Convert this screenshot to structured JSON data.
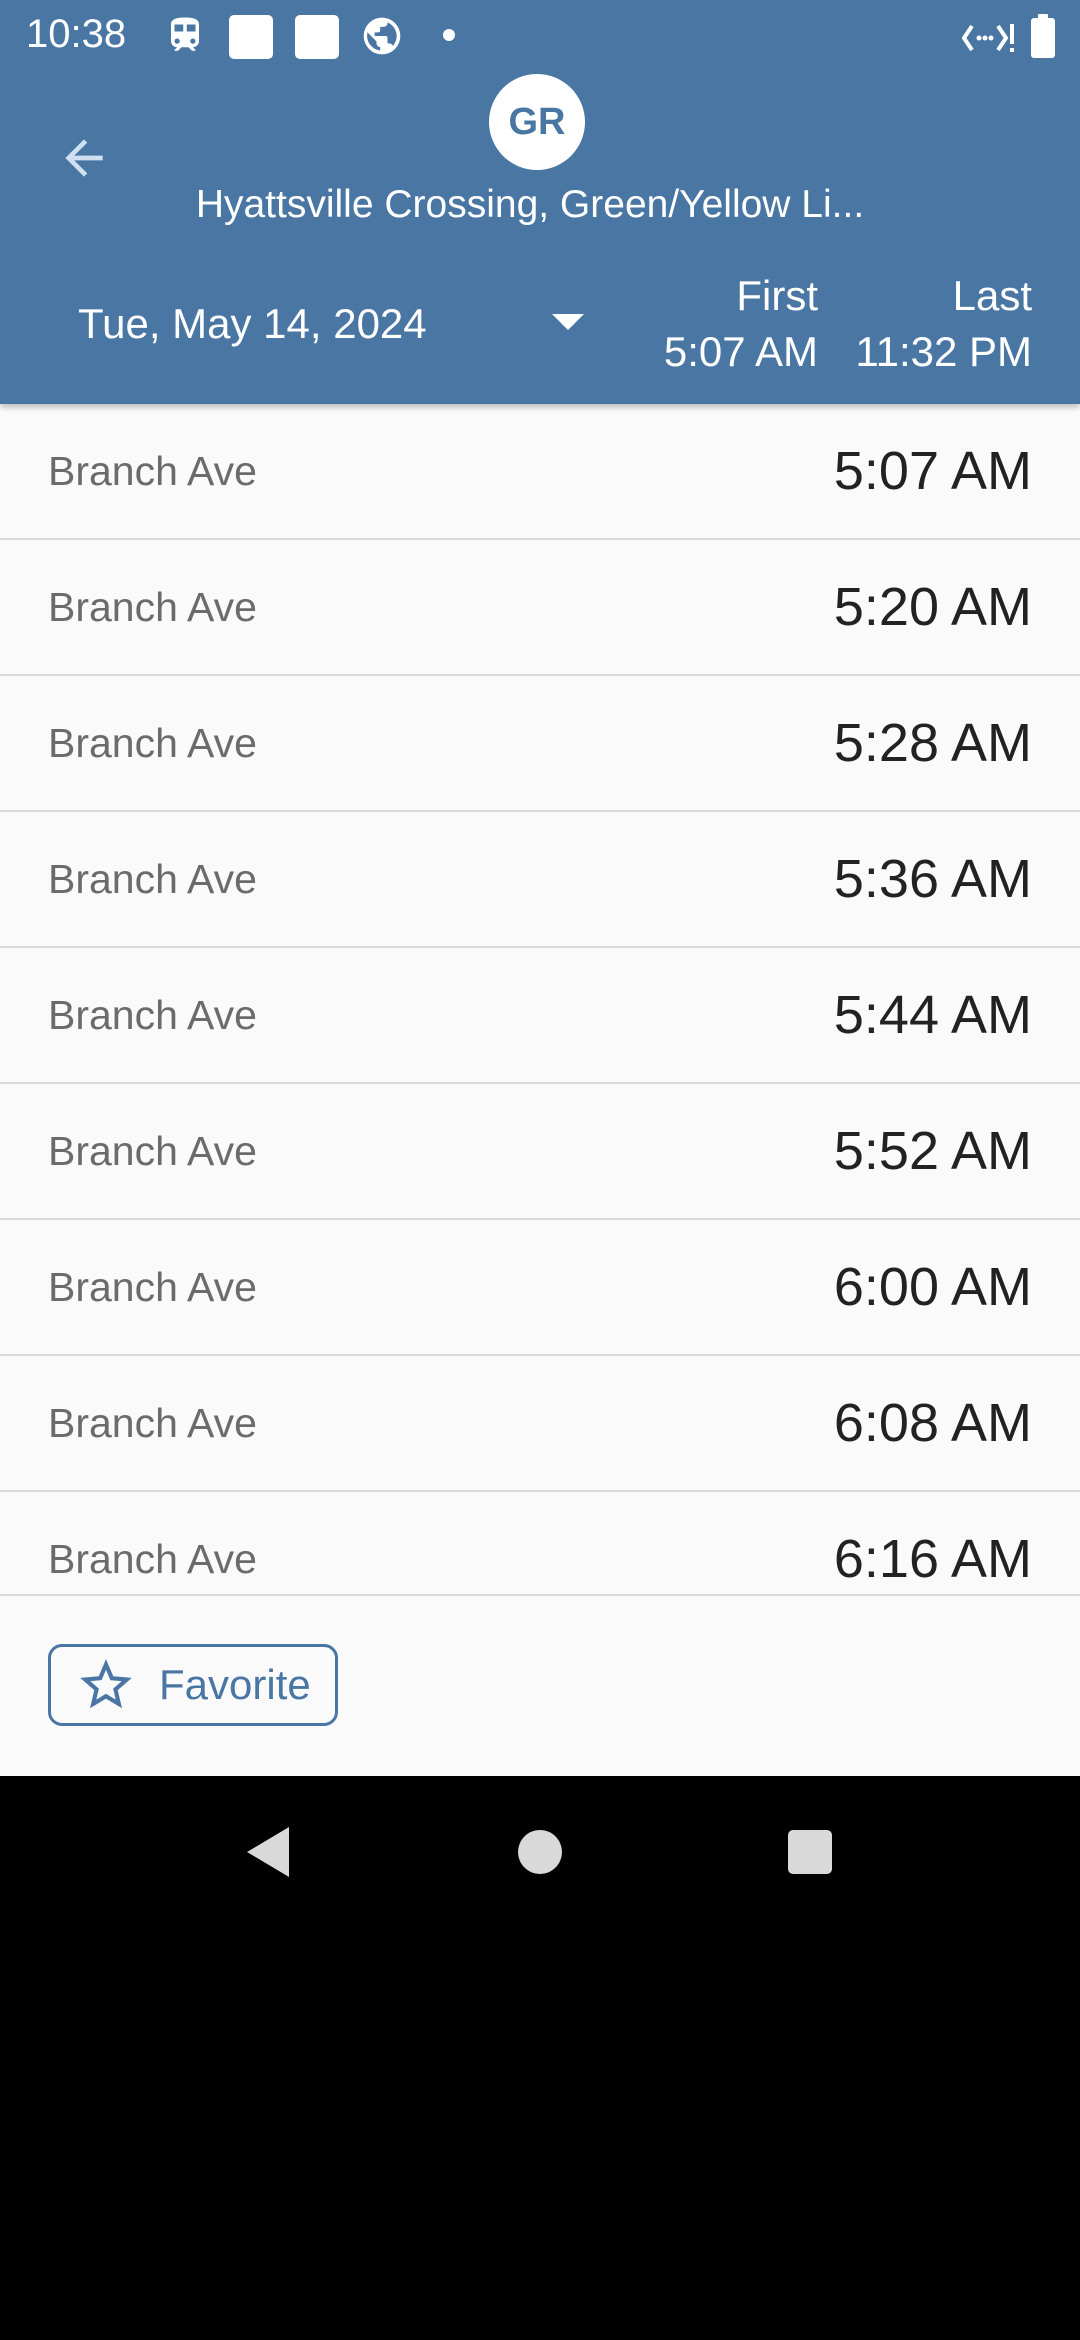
{
  "status_bar": {
    "time": "10:38",
    "icons": [
      "train-icon",
      "notification-square-icon",
      "notification-square-icon",
      "globe-icon",
      "dot-icon",
      "wifi-calling-icon",
      "battery-icon"
    ]
  },
  "header": {
    "back_icon": "arrow-left-icon",
    "line_badge": "GR",
    "station_title": "Hyattsville Crossing, Green/Yellow Li...",
    "date": "Tue, May 14, 2024",
    "first_label": "First",
    "first_time": "5:07 AM",
    "last_label": "Last",
    "last_time": "11:32 PM"
  },
  "schedule": [
    {
      "destination": "Branch Ave",
      "time": "5:07 AM"
    },
    {
      "destination": "Branch Ave",
      "time": "5:20 AM"
    },
    {
      "destination": "Branch Ave",
      "time": "5:28 AM"
    },
    {
      "destination": "Branch Ave",
      "time": "5:36 AM"
    },
    {
      "destination": "Branch Ave",
      "time": "5:44 AM"
    },
    {
      "destination": "Branch Ave",
      "time": "5:52 AM"
    },
    {
      "destination": "Branch Ave",
      "time": "6:00 AM"
    },
    {
      "destination": "Branch Ave",
      "time": "6:08 AM"
    },
    {
      "destination": "Branch Ave",
      "time": "6:16 AM"
    }
  ],
  "favorite": {
    "label": "Favorite",
    "icon": "star-outline-icon"
  },
  "colors": {
    "header": "#4a76a4",
    "background": "#fafafa",
    "accent": "#4a76a4"
  }
}
